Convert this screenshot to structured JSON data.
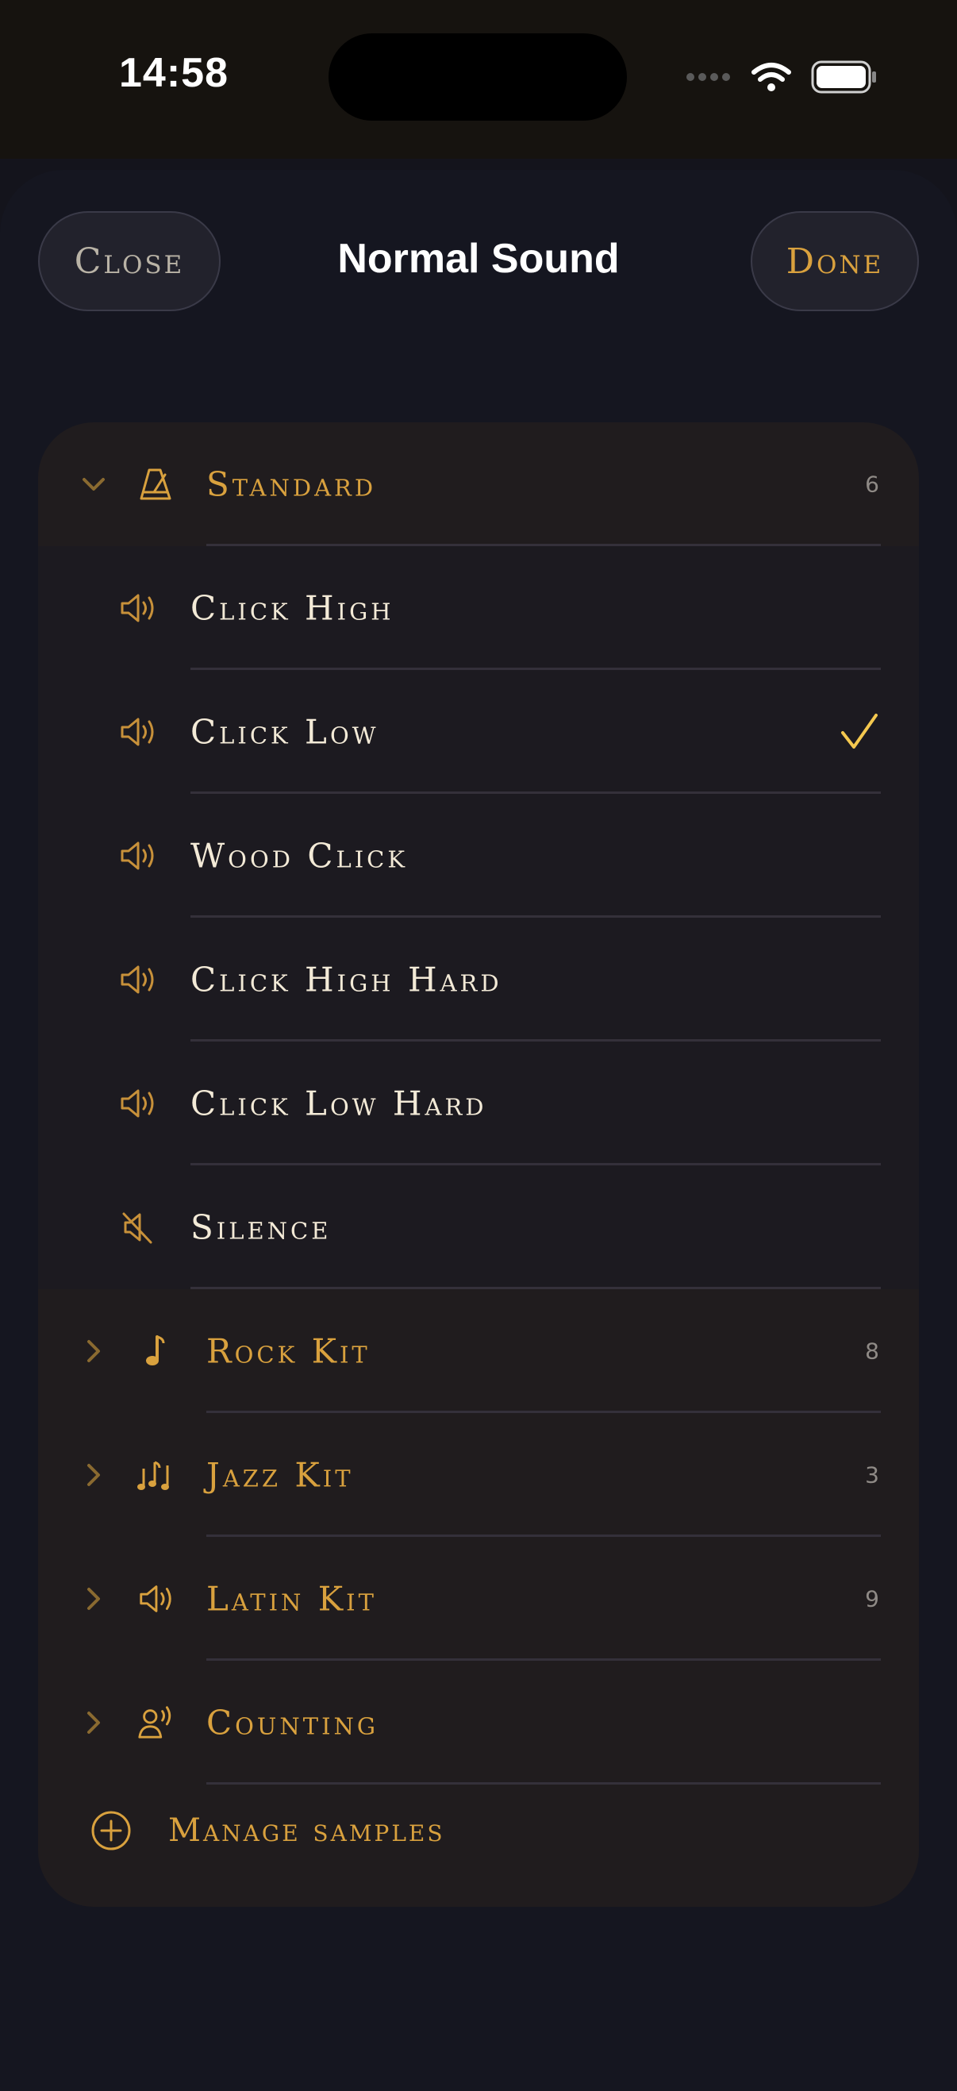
{
  "status_bar": {
    "time": "14:58"
  },
  "header": {
    "title": "Normal Sound",
    "close_label": "Close",
    "done_label": "Done"
  },
  "colors": {
    "accent": "#d9a13e",
    "check": "#f4c84f",
    "sound_text": "#f3ead7",
    "background": "#151620",
    "card": "#201c1e"
  },
  "groups": [
    {
      "label": "Standard",
      "count": "6",
      "icon": "metronome-icon",
      "expanded": true
    },
    {
      "label": "Rock Kit",
      "count": "8",
      "icon": "music-note-icon",
      "expanded": false
    },
    {
      "label": "Jazz Kit",
      "count": "3",
      "icon": "music-notes-icon",
      "expanded": false
    },
    {
      "label": "Latin Kit",
      "count": "9",
      "icon": "speaker-icon",
      "expanded": false
    },
    {
      "label": "Counting",
      "count": "",
      "icon": "voice-icon",
      "expanded": false
    }
  ],
  "sounds": [
    {
      "label": "Click High",
      "icon": "speaker-icon",
      "selected": false
    },
    {
      "label": "Click Low",
      "icon": "speaker-icon",
      "selected": true
    },
    {
      "label": "Wood Click",
      "icon": "speaker-icon",
      "selected": false
    },
    {
      "label": "Click High Hard",
      "icon": "speaker-icon",
      "selected": false
    },
    {
      "label": "Click Low Hard",
      "icon": "speaker-icon",
      "selected": false
    },
    {
      "label": "Silence",
      "icon": "speaker-muted-icon",
      "selected": false
    }
  ],
  "manage_label": "Manage samples"
}
